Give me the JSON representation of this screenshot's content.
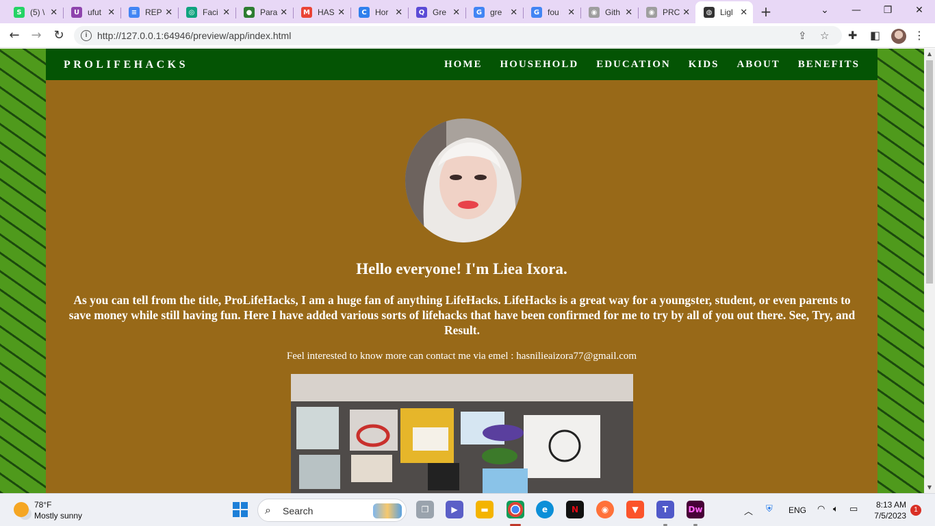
{
  "browser": {
    "tabs": [
      {
        "label": "(5) \\",
        "icon": "whatsapp-icon",
        "color": "#25d366",
        "glyph": "S"
      },
      {
        "label": "ufut",
        "icon": "ufuture-icon",
        "color": "#8e44ad",
        "glyph": "U"
      },
      {
        "label": "REP",
        "icon": "docs-icon",
        "color": "#4285f4",
        "glyph": "≡"
      },
      {
        "label": "Faci",
        "icon": "chatgpt-icon",
        "color": "#10a37f",
        "glyph": "◎"
      },
      {
        "label": "Para",
        "icon": "bot-icon",
        "color": "#2e7d32",
        "glyph": "●"
      },
      {
        "label": "HAS",
        "icon": "gmail-icon",
        "color": "#ea4335",
        "glyph": "M"
      },
      {
        "label": "Hor",
        "icon": "canva-icon",
        "color": "#2f80ed",
        "glyph": "C"
      },
      {
        "label": "Gre",
        "icon": "quillbot-icon",
        "color": "#5b4bd6",
        "glyph": "Q"
      },
      {
        "label": "gre",
        "icon": "google-icon",
        "color": "#4285f4",
        "glyph": "G"
      },
      {
        "label": "fou",
        "icon": "google-icon",
        "color": "#4285f4",
        "glyph": "G"
      },
      {
        "label": "Gith",
        "icon": "github-icon",
        "color": "#9e9e9e",
        "glyph": "◉"
      },
      {
        "label": "PRC",
        "icon": "github-icon",
        "color": "#9e9e9e",
        "glyph": "◉"
      },
      {
        "label": "Ligl",
        "icon": "globe-icon",
        "color": "#333333",
        "glyph": "◍"
      }
    ],
    "close_glyph": "✕",
    "url": "http://127.0.0.1:64946/preview/app/index.html"
  },
  "site": {
    "brand": "PROLIFEHACKS",
    "nav": [
      "HOME",
      "HOUSEHOLD",
      "EDUCATION",
      "KIDS",
      "ABOUT",
      "BENEFITS"
    ],
    "greeting": "Hello everyone! I'm Liea Ixora.",
    "intro": "As you can tell from the title, ProLifeHacks, I am a huge fan of anything LifeHacks. LifeHacks is a great way for a youngster, student, or even parents to save money while still having fun. Here I have added various sorts of lifehacks that have been confirmed for me to try by all of you out there. See, Try, and Result.",
    "contact": "Feel interested to know more can contact me via emel : hasnilieaizora77@gmail.com",
    "colors": {
      "nav_bg": "#045404",
      "body_bg": "#986918"
    }
  },
  "taskbar": {
    "weather_temp": "78°F",
    "weather_desc": "Mostly sunny",
    "search_label": "Search",
    "lang": "ENG",
    "time": "8:13 AM",
    "date": "7/5/2023",
    "notifications": "1"
  }
}
